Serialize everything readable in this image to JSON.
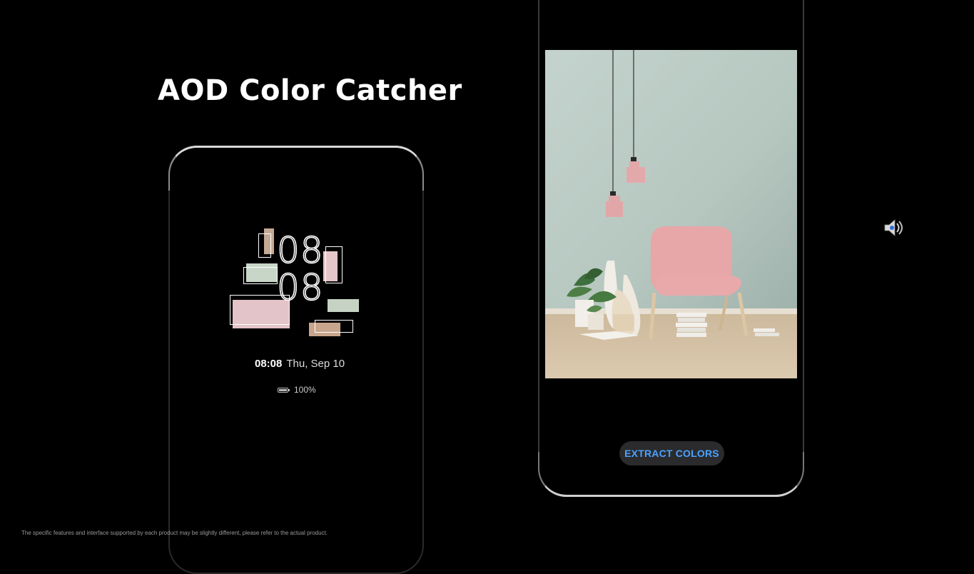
{
  "title": "AOD Color Catcher",
  "aod": {
    "clock_hours": "08",
    "clock_minutes": "08",
    "time": "08:08",
    "date": "Thu, Sep 10",
    "battery": "100%",
    "swatch_colors": [
      "#d7b6a5",
      "#e7cdd0",
      "#c7d2c6",
      "#d9bfb8",
      "#c9a68f"
    ]
  },
  "extract_button": "EXTRACT COLORS",
  "disclaimer": "The specific features and interface supported by each product may be slightly different, please refer to the actual product.",
  "icons": {
    "speaker": "speaker-volume-icon"
  },
  "colors": {
    "accent": "#4aa3ff",
    "background": "#000000",
    "wall": "#b8c9c2",
    "chair": "#e7a9a9",
    "floor": "#d8c5aa"
  }
}
